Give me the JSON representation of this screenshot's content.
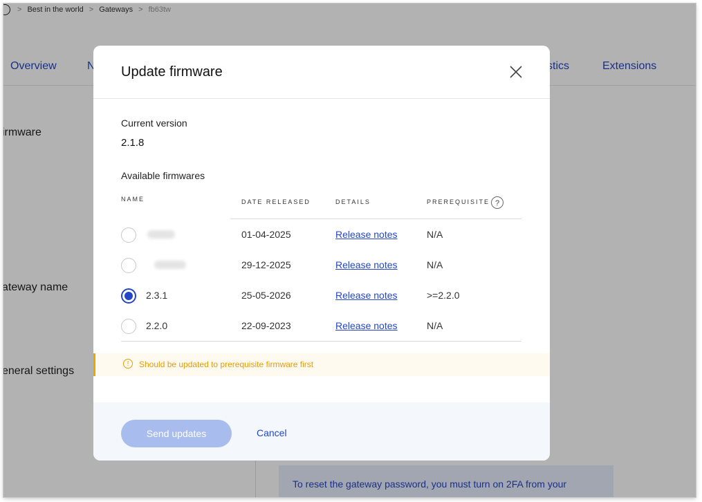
{
  "breadcrumb": {
    "items": [
      "Best in the world",
      "Gateways",
      "fb63tw"
    ],
    "separator": ">"
  },
  "tabs": [
    {
      "label": "Overview"
    },
    {
      "label": "N"
    },
    {
      "label": "stics"
    },
    {
      "label": "Extensions"
    }
  ],
  "side_sections": [
    "irmware",
    "ateway name",
    "eneral settings"
  ],
  "info_box": {
    "text": "To reset the gateway password, you must turn on 2FA from your"
  },
  "modal": {
    "title": "Update firmware",
    "current_version_label": "Current version",
    "current_version": "2.1.8",
    "available_label": "Available firmwares",
    "columns": {
      "name": "NAME",
      "date": "DATE RELEASED",
      "details": "DETAILS",
      "prerequisite": "PREREQUISITE"
    },
    "help_glyph": "?",
    "rows": [
      {
        "name": "",
        "date": "01-04-2025",
        "details": "Release notes",
        "prerequisite": "N/A",
        "selected": false
      },
      {
        "name": "",
        "date": "29-12-2025",
        "details": "Release notes",
        "prerequisite": "N/A",
        "selected": false
      },
      {
        "name": "2.3.1",
        "date": "25-05-2026",
        "details": "Release notes",
        "prerequisite": ">=2.2.0",
        "selected": true
      },
      {
        "name": "2.2.0",
        "date": "22-09-2023",
        "details": "Release notes",
        "prerequisite": "N/A",
        "selected": false
      }
    ],
    "warning": {
      "glyph": "!",
      "text": "Should be updated to prerequisite firmware first"
    },
    "send_button": "Send updates",
    "cancel_button": "Cancel"
  },
  "colors": {
    "accent": "#2346c7",
    "warning": "#e69c00",
    "disabled_button": "#a8bced"
  },
  "icons": {
    "close": "close-icon",
    "help": "help-icon",
    "warning": "warning-icon",
    "home": "home-icon"
  }
}
